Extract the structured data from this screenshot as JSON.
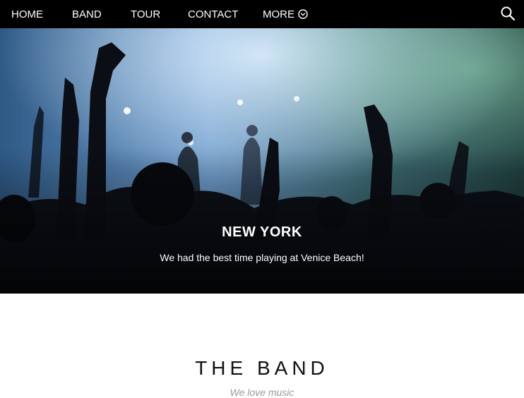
{
  "nav": {
    "items": [
      {
        "label": "HOME"
      },
      {
        "label": "BAND"
      },
      {
        "label": "TOUR"
      },
      {
        "label": "CONTACT"
      },
      {
        "label": "MORE"
      }
    ],
    "more_icon": "chevron-down-circle-icon",
    "search_icon": "search-icon"
  },
  "hero": {
    "title": "NEW YORK",
    "subtitle": "We had the best time playing at Venice Beach!"
  },
  "section": {
    "title": "THE BAND",
    "subtitle": "We love music"
  },
  "colors": {
    "nav_bg": "#000000",
    "nav_text": "#ffffff",
    "subtitle_gray": "#9a9a9a"
  }
}
